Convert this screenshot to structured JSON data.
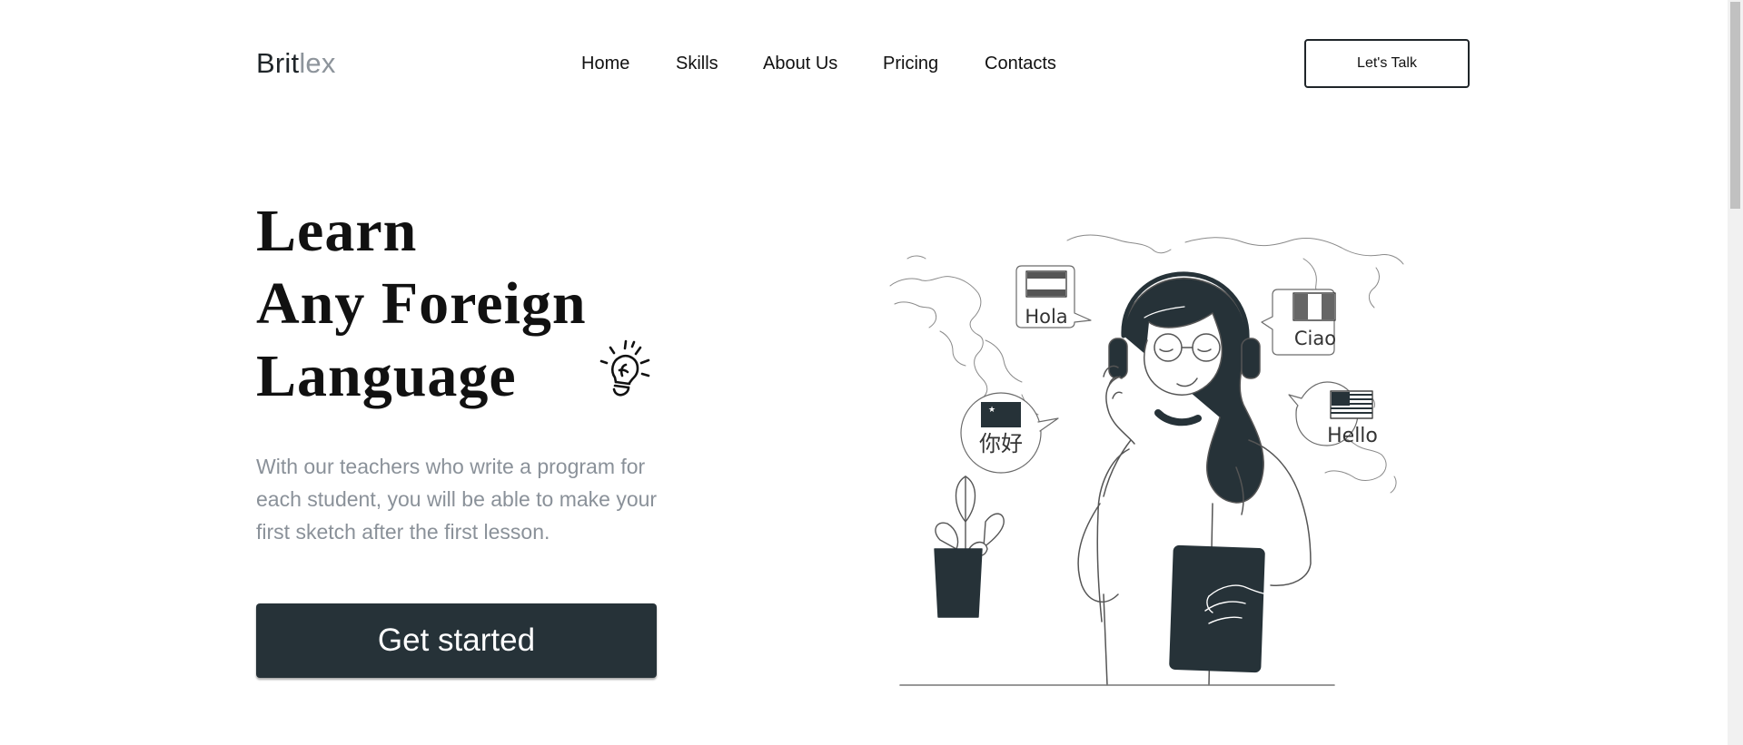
{
  "brand": {
    "part1": "Brit",
    "part2": "lex"
  },
  "nav": {
    "items": [
      {
        "label": "Home"
      },
      {
        "label": "Skills"
      },
      {
        "label": "About Us"
      },
      {
        "label": "Pricing"
      },
      {
        "label": "Contacts"
      }
    ],
    "cta_label": "Let's Talk"
  },
  "hero": {
    "title_lines": [
      "Learn",
      "Any Foreign",
      "Language"
    ],
    "subtitle": "With our teachers who write a program for each student, you will be able to make your first sketch after the first lesson.",
    "cta_label": "Get started"
  },
  "illustration": {
    "bubbles": {
      "spanish": "Hola",
      "italian": "Ciao",
      "chinese": "你好",
      "english": "Hello"
    }
  },
  "colors": {
    "accent": "#263238",
    "muted": "#8a9199",
    "background": "#ffffff"
  }
}
